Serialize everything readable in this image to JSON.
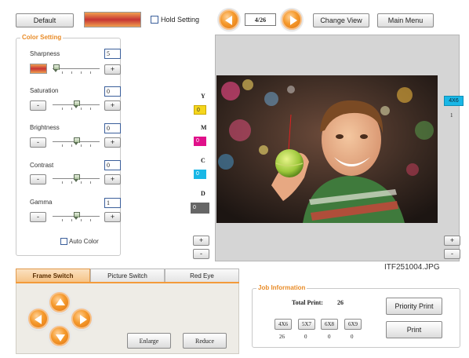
{
  "toolbar": {
    "default_label": "Default",
    "hold_setting_label": "Hold Setting",
    "page_counter": "4/26",
    "change_view_label": "Change View",
    "main_menu_label": "Main Menu"
  },
  "color_setting": {
    "title": "Color Setting",
    "sharpness": {
      "label": "Sharpness",
      "value": "5",
      "level": 0.0
    },
    "saturation": {
      "label": "Saturation",
      "value": "0",
      "level": 0.5
    },
    "brightness": {
      "label": "Brightness",
      "value": "0",
      "level": 0.5
    },
    "contrast": {
      "label": "Contrast",
      "value": "0",
      "level": 0.5
    },
    "gamma": {
      "label": "Gamma",
      "value": "1",
      "level": 0.5
    },
    "minus": "-",
    "plus": "+",
    "auto_color_label": "Auto Color"
  },
  "ymcd": {
    "y": {
      "label": "Y",
      "value": "0",
      "color": "#f5d61c"
    },
    "m": {
      "label": "M",
      "value": "0",
      "color": "#e0108a"
    },
    "c": {
      "label": "C",
      "value": "0",
      "color": "#19b7e6"
    },
    "d": {
      "label": "D",
      "value": "0",
      "color": "#666666"
    },
    "plus": "+",
    "minus": "-"
  },
  "right_side": {
    "size_badge": "4X6",
    "count": "1",
    "plus": "+",
    "minus": "-"
  },
  "photo": {
    "filename": "ITF251004.JPG"
  },
  "tabs": {
    "frame_switch": "Frame Switch",
    "picture_switch": "Picture Switch",
    "red_eye": "Red Eye"
  },
  "frame_panel": {
    "enlarge_label": "Enlarge",
    "reduce_label": "Reduce"
  },
  "job": {
    "title": "Job Information",
    "total_print_label": "Total Print:",
    "total_print_value": "26",
    "sizes": [
      {
        "label": "4X6",
        "count": "26"
      },
      {
        "label": "5X7",
        "count": "0"
      },
      {
        "label": "6X8",
        "count": "0"
      },
      {
        "label": "6X9",
        "count": "0"
      }
    ],
    "priority_print_label": "Priority Print",
    "print_label": "Print"
  }
}
